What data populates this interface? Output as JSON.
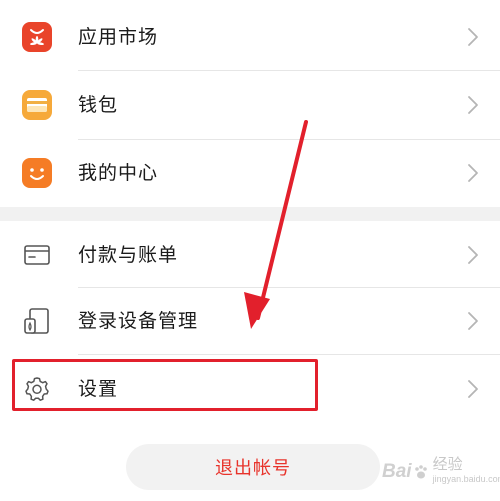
{
  "menu": {
    "group1": [
      {
        "label": "应用市场",
        "icon": "app-market-icon"
      },
      {
        "label": "钱包",
        "icon": "wallet-icon"
      },
      {
        "label": "我的中心",
        "icon": "my-center-icon"
      }
    ],
    "group2": [
      {
        "label": "付款与账单",
        "icon": "card-icon"
      },
      {
        "label": "登录设备管理",
        "icon": "devices-icon"
      },
      {
        "label": "设置",
        "icon": "gear-icon"
      }
    ]
  },
  "logout": {
    "label": "退出帐号"
  },
  "annotation": {
    "highlight_color": "#e2202c",
    "target": "设置"
  },
  "watermark": {
    "brand": "Bai",
    "suffix": "经验",
    "domain": "jingyan.baidu.com"
  },
  "colors": {
    "accent_red": "#e8332b",
    "separator": "#f1f1f1",
    "text": "#1b1b1b"
  }
}
